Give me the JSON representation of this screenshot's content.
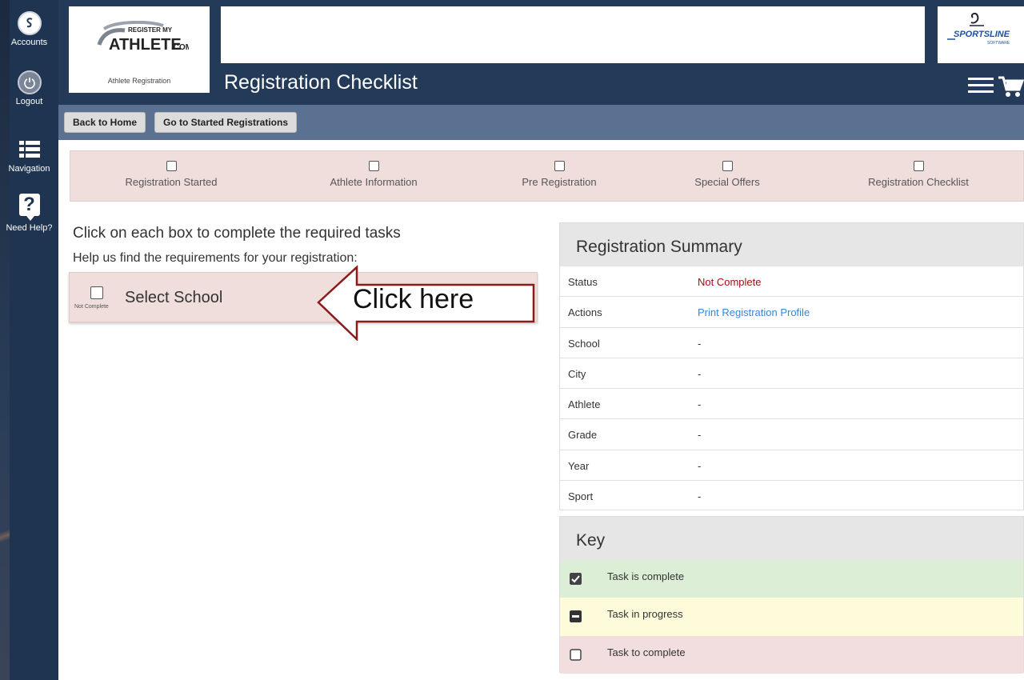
{
  "leftnav": {
    "items": [
      {
        "label": "Accounts"
      },
      {
        "label": "Logout"
      },
      {
        "label": "Navigation"
      },
      {
        "label": "Need Help?"
      }
    ]
  },
  "header": {
    "logo_line1": "REGISTER MY",
    "logo_line2": "ATHLETE",
    "logo_line3": ".COM",
    "logo_sub": "Athlete Registration",
    "sportsline": "SPORTSLINE",
    "sportsline_sub": "SOFTWARE",
    "page_title": "Registration Checklist"
  },
  "toolbar": {
    "back_label": "Back to Home",
    "started_label": "Go to Started Registrations"
  },
  "progress": {
    "steps": [
      {
        "label": "Registration Started"
      },
      {
        "label": "Athlete Information"
      },
      {
        "label": "Pre Registration"
      },
      {
        "label": "Special Offers"
      },
      {
        "label": "Registration Checklist"
      }
    ]
  },
  "main": {
    "instruction": "Click on each box to complete the required tasks",
    "help": "Help us find the requirements for your registration:",
    "task": {
      "name": "Select School",
      "status": "Not Complete"
    },
    "callout": "Click here"
  },
  "summary": {
    "title": "Registration Summary",
    "rows": [
      {
        "key": "Status",
        "value": "Not Complete"
      },
      {
        "key": "Actions",
        "value": "Print Registration Profile"
      },
      {
        "key": "School",
        "value": "-"
      },
      {
        "key": "City",
        "value": "-"
      },
      {
        "key": "Athlete",
        "value": "-"
      },
      {
        "key": "Grade",
        "value": "-"
      },
      {
        "key": "Year",
        "value": "-"
      },
      {
        "key": "Sport",
        "value": "-"
      }
    ]
  },
  "key": {
    "title": "Key",
    "rows": [
      {
        "label": "Task is complete",
        "color": "#dcefd6"
      },
      {
        "label": "Task in progress",
        "color": "#fdfbd9"
      },
      {
        "label": "Task to complete",
        "color": "#f2dede"
      }
    ]
  },
  "colors": {
    "header_bg": "#233a59",
    "toolbar_bg": "#5b7191",
    "status_red": "#a01010",
    "link_blue": "#3a86d6"
  }
}
